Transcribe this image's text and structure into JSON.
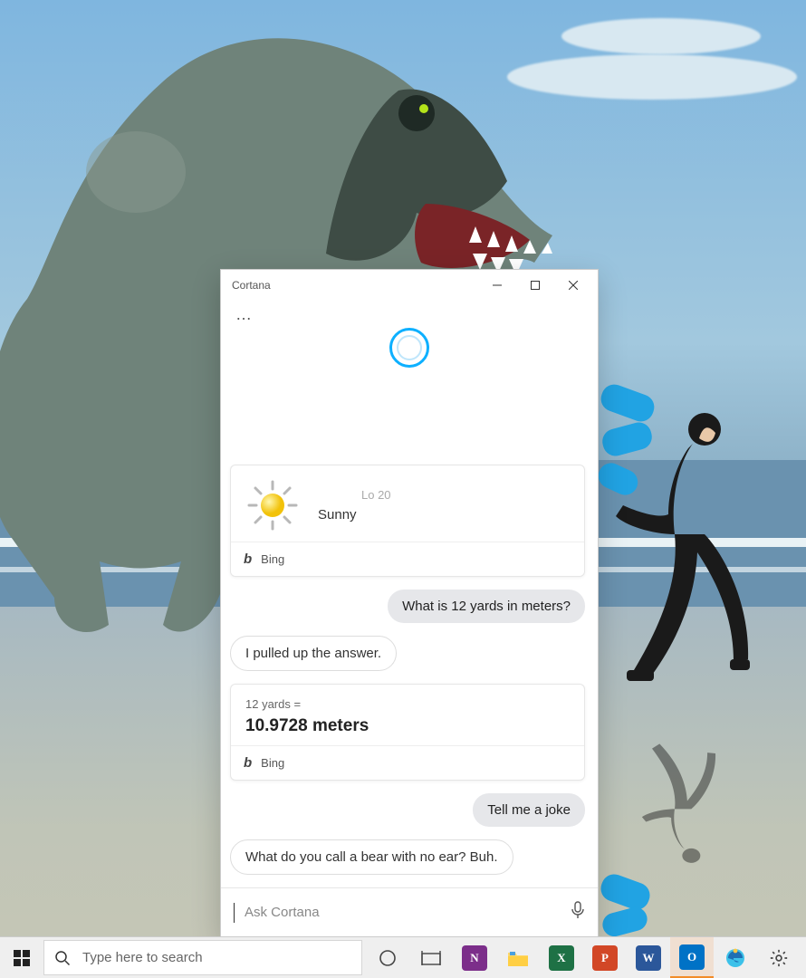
{
  "window": {
    "title": "Cortana"
  },
  "weather": {
    "lo": "Lo 20",
    "condition": "Sunny",
    "source": "Bing"
  },
  "conversionQuery": "What is 12 yards in meters?",
  "conversionReply": "I pulled up the answer.",
  "conversion": {
    "from": "12 yards =",
    "to": "10.9728 meters",
    "source": "Bing"
  },
  "jokeQuery": "Tell me a joke",
  "jokeReply": "What do you call a bear with no ear? Buh.",
  "input": {
    "placeholder": "Ask Cortana"
  },
  "taskbar": {
    "search_placeholder": "Type here to search"
  }
}
